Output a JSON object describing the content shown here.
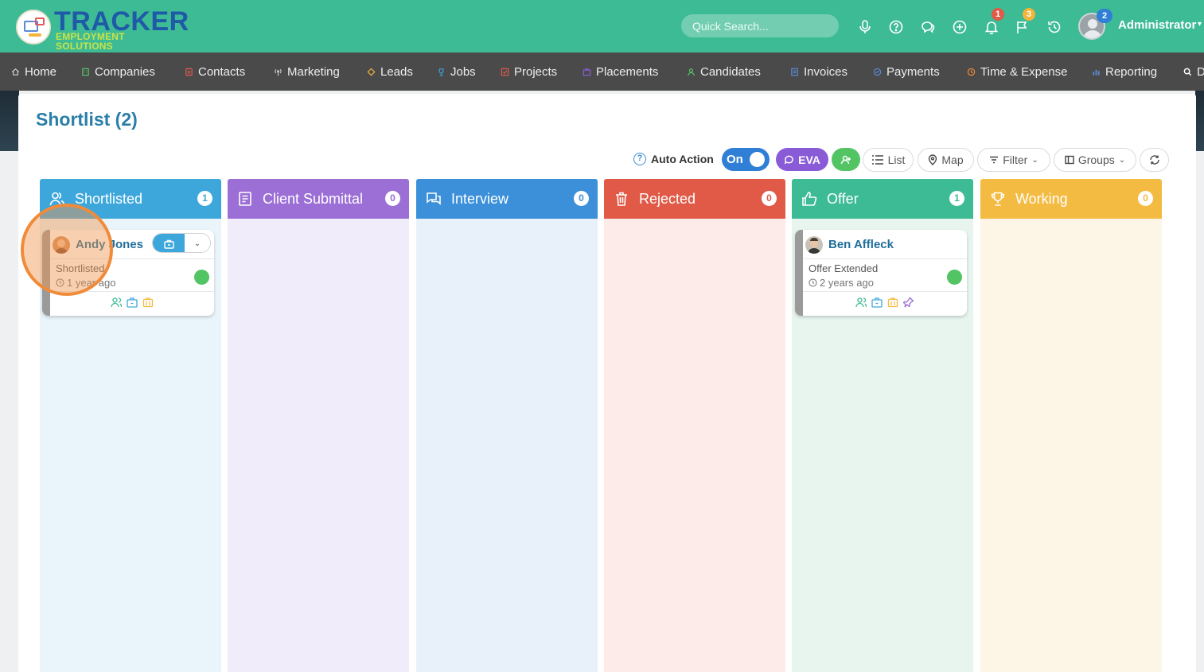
{
  "brand": {
    "title": "TRACKER",
    "subtitle": "EMPLOYMENT SOLUTIONS"
  },
  "topbar": {
    "search_placeholder": "Quick Search...",
    "icons": [
      "microphone-icon",
      "help-icon",
      "chat-icon",
      "add-icon",
      "bell-icon",
      "flag-icon",
      "history-icon"
    ],
    "notifications_count": "1",
    "flags_count": "3",
    "user_badge": "2",
    "user_name": "Administrator"
  },
  "nav": {
    "items": [
      {
        "label": "Home",
        "color": "#cfcfcf"
      },
      {
        "label": "Companies",
        "color": "#58c46b"
      },
      {
        "label": "Contacts",
        "color": "#e05a4f"
      },
      {
        "label": "Marketing",
        "color": "#cfcfcf"
      },
      {
        "label": "Leads",
        "color": "#f2b53c"
      },
      {
        "label": "Jobs",
        "color": "#3da7dc"
      },
      {
        "label": "Projects",
        "color": "#e05a4f"
      },
      {
        "label": "Placements",
        "color": "#8a5bd6"
      },
      {
        "label": "Candidates",
        "color": "#58c46b"
      },
      {
        "label": "Invoices",
        "color": "#5b8bd6"
      },
      {
        "label": "Payments",
        "color": "#5b8bd6"
      },
      {
        "label": "Time & Expense",
        "color": "#f08b3a"
      },
      {
        "label": "Reporting",
        "color": "#5b8bd6"
      },
      {
        "label": "D",
        "color": "#ffffff"
      }
    ]
  },
  "page": {
    "title": "Shortlist (2)"
  },
  "toolbar": {
    "auto_action_label": "Auto Action",
    "toggle_label": "On",
    "eva_label": "EVA",
    "list_label": "List",
    "map_label": "Map",
    "filter_label": "Filter",
    "groups_label": "Groups"
  },
  "columns": [
    {
      "title": "Shortlisted",
      "count": "1",
      "color": "#3da7dc",
      "body_color": "#e9f5fb",
      "count_color": "#3da7dc",
      "icon": "users-icon"
    },
    {
      "title": "Client Submittal",
      "count": "0",
      "color": "#9b6fd6",
      "body_color": "#f1ecfa",
      "count_color": "#9b6fd6",
      "icon": "document-icon"
    },
    {
      "title": "Interview",
      "count": "0",
      "color": "#3b90d9",
      "body_color": "#e8f1fa",
      "count_color": "#3b90d9",
      "icon": "comments-icon"
    },
    {
      "title": "Rejected",
      "count": "0",
      "color": "#e05a47",
      "body_color": "#fcebe8",
      "count_color": "#e05a47",
      "icon": "trash-icon"
    },
    {
      "title": "Offer",
      "count": "1",
      "color": "#3dbb94",
      "body_color": "#e8f5ef",
      "count_color": "#3dbb94",
      "icon": "thumbs-up-icon"
    },
    {
      "title": "Working",
      "count": "0",
      "color": "#f4bb42",
      "body_color": "#fdf6e6",
      "count_color": "#f4bb42",
      "icon": "trophy-icon"
    }
  ],
  "cards": [
    {
      "name": "Andy Jones",
      "status": "Shortlisted",
      "time": "1 year ago",
      "column": "Shortlisted"
    },
    {
      "name": "Ben Affleck",
      "status": "Offer Extended",
      "time": "2 years ago",
      "column": "Offer"
    }
  ]
}
